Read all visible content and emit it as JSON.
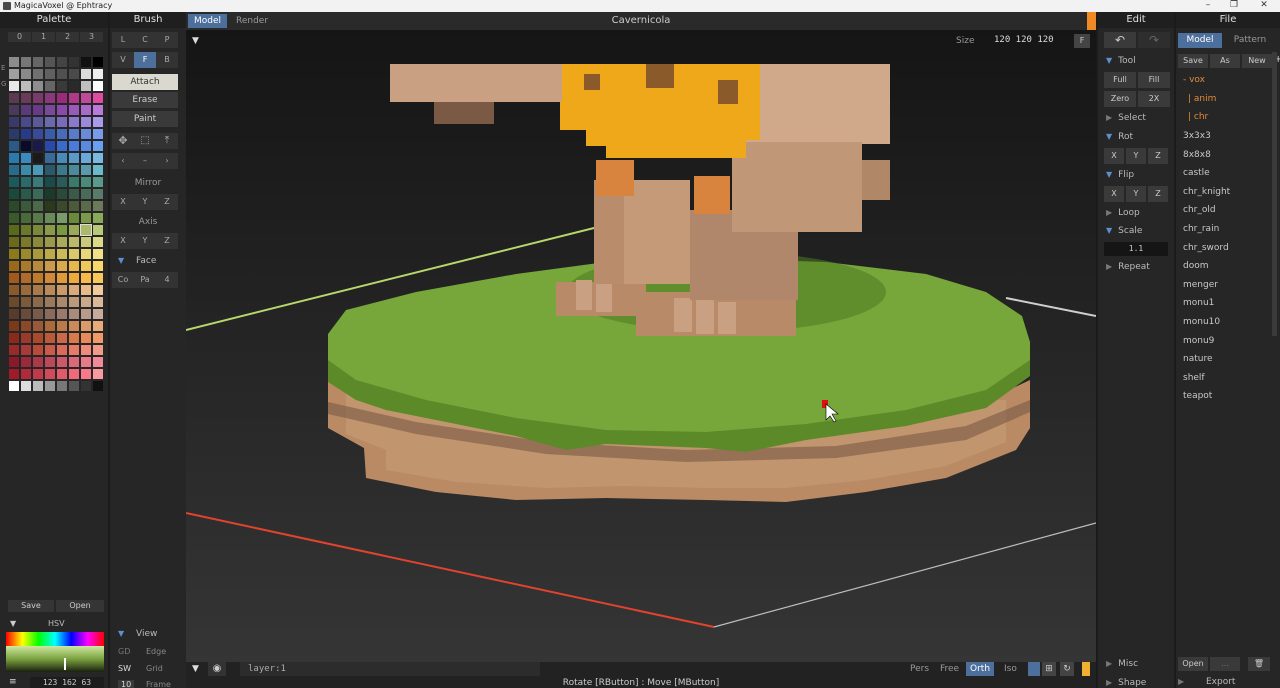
{
  "window": {
    "title": "MagicaVoxel @ Ephtracy",
    "controls": [
      "–",
      "❐",
      "✕"
    ]
  },
  "palette": {
    "title": "Palette",
    "tabs": [
      "0",
      "1",
      "2",
      "3"
    ],
    "side_letters": [
      "E",
      "G"
    ],
    "save_label": "Save",
    "open_label": "Open",
    "hsv_label": "HSV",
    "rgb_value": "123 162 63",
    "colors": [
      "#8c8c8c",
      "#777",
      "#666",
      "#555",
      "#444",
      "#333",
      "#111",
      "#000",
      "#a0a0a0",
      "#8a8a8a",
      "#707070",
      "#606060",
      "#505050",
      "#4a4a4a",
      "#dcdcdc",
      "#eee",
      "#e8e8e8",
      "#bdbdbd",
      "#8e8e8e",
      "#666",
      "#3a3a3a",
      "#2a2a2a",
      "#c0c0c0",
      "#fff",
      "#5a3a4e",
      "#6a3a5a",
      "#7a3a6a",
      "#8a3a7a",
      "#9a2a7a",
      "#b03a8a",
      "#c04a9a",
      "#e04aa0",
      "#4a3a5a",
      "#5a3a7a",
      "#6a3a8a",
      "#7a4a9a",
      "#8a4aaa",
      "#9a5aba",
      "#aa6aca",
      "#ba7ada",
      "#3a3a6a",
      "#4a4a8a",
      "#5a5a9a",
      "#6a6aaa",
      "#7a6aba",
      "#8a7aca",
      "#9a8ada",
      "#aa9aea",
      "#2a3a6a",
      "#2a3a8a",
      "#3a4a9a",
      "#3a5aaa",
      "#4a6aba",
      "#5a7aca",
      "#6a8ada",
      "#7a9aea",
      "#2a5a8a",
      "#0a0a2a",
      "#1a1a4a",
      "#2a4aaa",
      "#3a6aca",
      "#4a7ada",
      "#5a8ae0",
      "#6aa0f0",
      "#2a7ab0",
      "#3a8ac0",
      "#1a1a1a",
      "#3a6a9a",
      "#4a8ab8",
      "#5a9ac8",
      "#6aaad8",
      "#7abae0",
      "#2a6a8a",
      "#3a8aa8",
      "#4a9ab8",
      "#2a5a6a",
      "#3a7a8a",
      "#4a8a9a",
      "#5a9aaa",
      "#6abaca",
      "#1a5a5a",
      "#2a6a6a",
      "#3a7a7a",
      "#1a4a4a",
      "#2a5a5a",
      "#3a7a6a",
      "#4a8a7a",
      "#5a9a8a",
      "#1a4a3a",
      "#2a5a4a",
      "#3a6a5a",
      "#1a3a2a",
      "#2a4a3a",
      "#3a5a4a",
      "#4a6a5a",
      "#5a7a6a",
      "#2a4a2a",
      "#3a5a3a",
      "#4a6a4a",
      "#2a3a1a",
      "#3a4a2a",
      "#4a5a3a",
      "#5a6a4a",
      "#6a7a5a",
      "#3a5a2a",
      "#4a6a3a",
      "#5a7a4a",
      "#6a8a5a",
      "#7a9a6a",
      "#6a8a3a",
      "#7a9a4a",
      "#8aaa5a",
      "#5a6a1a",
      "#6a7a2a",
      "#7a8a3a",
      "#8a9a4a",
      "#7a9a3f",
      "#9aaa5a",
      "#aaba6a",
      "#bac87a",
      "#6a6a1a",
      "#7a7a2a",
      "#8a8a3a",
      "#9a9a4a",
      "#aaaa5a",
      "#baba6a",
      "#caca7a",
      "#dada8a",
      "#8a7a1a",
      "#9a8a2a",
      "#aa9a3a",
      "#baaa4a",
      "#caba5a",
      "#dac86a",
      "#e8d87a",
      "#f0e08a",
      "#9a6a1a",
      "#aa7a2a",
      "#ba8a3a",
      "#ca9a4a",
      "#daaa4a",
      "#e8b84a",
      "#f0c85a",
      "#f8d86a",
      "#a05a1a",
      "#b06a2a",
      "#c07a2a",
      "#d08a3a",
      "#e09a3a",
      "#f0aa3a",
      "#f8b84a",
      "#f8c85a",
      "#8a5a2a",
      "#9a6a3a",
      "#aa7a4a",
      "#ba8a5a",
      "#ca9a6a",
      "#daaa7a",
      "#e8ba8a",
      "#f0ca9a",
      "#6a4a2a",
      "#7a5a3a",
      "#8a6a4a",
      "#9a7a5a",
      "#aa8a6a",
      "#ba9a7a",
      "#caa88a",
      "#dab89a",
      "#5a3a2a",
      "#6a4a3a",
      "#7a5a4a",
      "#8a6a5a",
      "#9a7a6a",
      "#aa8a7a",
      "#ba9a8a",
      "#caaa9a",
      "#7a3a1a",
      "#8a4a2a",
      "#9a5a3a",
      "#aa6a3a",
      "#ba7a4a",
      "#ca8a5a",
      "#da9a6a",
      "#e8aa7a",
      "#8a2a1a",
      "#9a3a2a",
      "#aa4a2a",
      "#ba5a3a",
      "#ca6a4a",
      "#da7a4a",
      "#e88a5a",
      "#f09a6a",
      "#9a2a2a",
      "#aa3a3a",
      "#ba4a3a",
      "#ca5a4a",
      "#da6a5a",
      "#e87a6a",
      "#f08a7a",
      "#f09a8a",
      "#8a1a2a",
      "#9a2a3a",
      "#aa3a4a",
      "#ba4a5a",
      "#ca5a6a",
      "#da6a7a",
      "#e87a8a",
      "#f08a9a",
      "#a01a2a",
      "#b02a3a",
      "#c03a4a",
      "#d04a5a",
      "#e05a6a",
      "#f06a7a",
      "#f87a8a",
      "#f89aa0",
      "#fff",
      "#ddd",
      "#bbb",
      "#999",
      "#777",
      "#555",
      "#333",
      "#111"
    ]
  },
  "brush": {
    "title": "Brush",
    "modes_row1": [
      "L",
      "C",
      "P"
    ],
    "modes_row2": [
      "V",
      "F",
      "B"
    ],
    "attach_label": "Attach",
    "erase_label": "Erase",
    "paint_label": "Paint",
    "mirror_label": "Mirror",
    "axis_label": "Axis",
    "xyz": [
      "X",
      "Y",
      "Z"
    ],
    "face_label": "Face",
    "face_opts": [
      "Co",
      "Pa",
      "4"
    ],
    "view_label": "View",
    "view_items": [
      {
        "key": "GD",
        "label": "Edge"
      },
      {
        "key": "SW",
        "label": "Grid"
      },
      {
        "key": "10",
        "label": "Frame"
      }
    ]
  },
  "viewport": {
    "tab_model": "Model",
    "tab_render": "Render",
    "title": "Cavernicola",
    "size_label": "Size",
    "size_value": "120 120 120",
    "size_btn": "F",
    "layer_value": "layer:1",
    "cam_modes": [
      "Pers",
      "Free",
      "Orth",
      "Iso"
    ],
    "status": "Rotate [RButton] : Move [MButton]",
    "accent": "#4d6f9c"
  },
  "edit": {
    "title": "Edit",
    "tool_label": "Tool",
    "tool_btns": [
      "Full",
      "Fill",
      "Zero",
      "2X"
    ],
    "select_label": "Select",
    "rot_label": "Rot",
    "flip_label": "Flip",
    "loop_label": "Loop",
    "scale_label": "Scale",
    "scale_value": "1.1",
    "repeat_label": "Repeat",
    "xyz": [
      "X",
      "Y",
      "Z"
    ],
    "misc_label": "Misc",
    "shape_label": "Shape"
  },
  "file": {
    "title": "File",
    "tab_model": "Model",
    "tab_pattern": "Pattern",
    "save_label": "Save",
    "as_label": "As",
    "new_label": "New",
    "tree": [
      "- vox",
      "| anim",
      "| chr"
    ],
    "items": [
      "3x3x3",
      "8x8x8",
      "castle",
      "chr_knight",
      "chr_old",
      "chr_rain",
      "chr_sword",
      "doom",
      "menger",
      "monu1",
      "monu10",
      "monu9",
      "nature",
      "shelf",
      "teapot"
    ],
    "open_label": "Open",
    "dots_label": "...",
    "export_label": "Export"
  }
}
